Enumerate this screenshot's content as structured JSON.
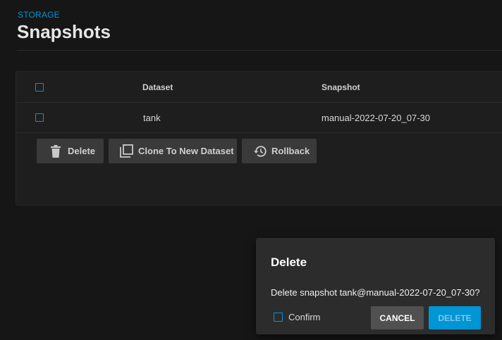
{
  "header": {
    "breadcrumb": "STORAGE",
    "title": "Snapshots"
  },
  "table": {
    "columns": [
      "Dataset",
      "Snapshot"
    ],
    "rows": [
      {
        "dataset": "tank",
        "snapshot": "manual-2022-07-20_07-30"
      }
    ]
  },
  "row_actions": {
    "delete_label": "Delete",
    "clone_label": "Clone To New Dataset",
    "rollback_label": "Rollback"
  },
  "dialog": {
    "title": "Delete",
    "message": "Delete snapshot tank@manual-2022-07-20_07-30?",
    "confirm_label": "Confirm",
    "cancel_label": "CANCEL",
    "delete_label": "DELETE"
  },
  "colors": {
    "accent": "#0095d5",
    "background": "#161616",
    "card": "#1e1e1e",
    "dialog": "#2c2c2c"
  },
  "icons": {
    "delete": "trash-icon",
    "clone": "copy-icon",
    "rollback": "history-icon"
  }
}
